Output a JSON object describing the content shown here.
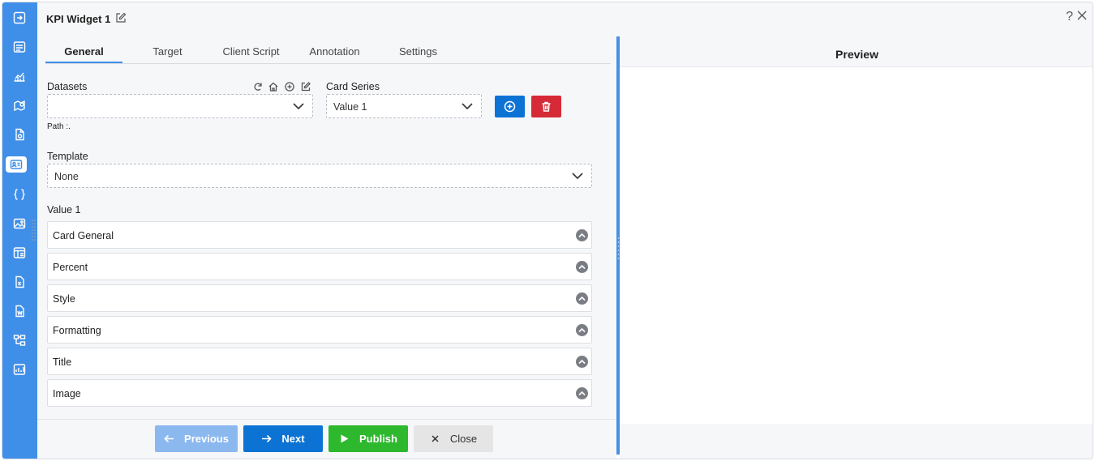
{
  "header": {
    "title": "KPI Widget 1",
    "help": "?"
  },
  "tabs": [
    {
      "label": "General",
      "active": true
    },
    {
      "label": "Target",
      "active": false
    },
    {
      "label": "Client Script",
      "active": false
    },
    {
      "label": "Annotation",
      "active": false
    },
    {
      "label": "Settings",
      "active": false
    }
  ],
  "form": {
    "datasets_label": "Datasets",
    "datasets_value": "",
    "path_label": "Path :.",
    "card_series_label": "Card Series",
    "card_series_value": "Value 1",
    "template_label": "Template",
    "template_value": "None",
    "value_section_label": "Value 1"
  },
  "accordion": [
    "Card General",
    "Percent",
    "Style",
    "Formatting",
    "Title",
    "Image"
  ],
  "footer": {
    "previous": "Previous",
    "next": "Next",
    "publish": "Publish",
    "close": "Close"
  },
  "preview": {
    "title": "Preview"
  },
  "colors": {
    "rail": "#3f8fe8",
    "primary": "#0c73d4",
    "danger": "#d62b36",
    "success": "#2eb82e",
    "disabled": "#8ab8ef",
    "neutral": "#e5e5e5"
  }
}
